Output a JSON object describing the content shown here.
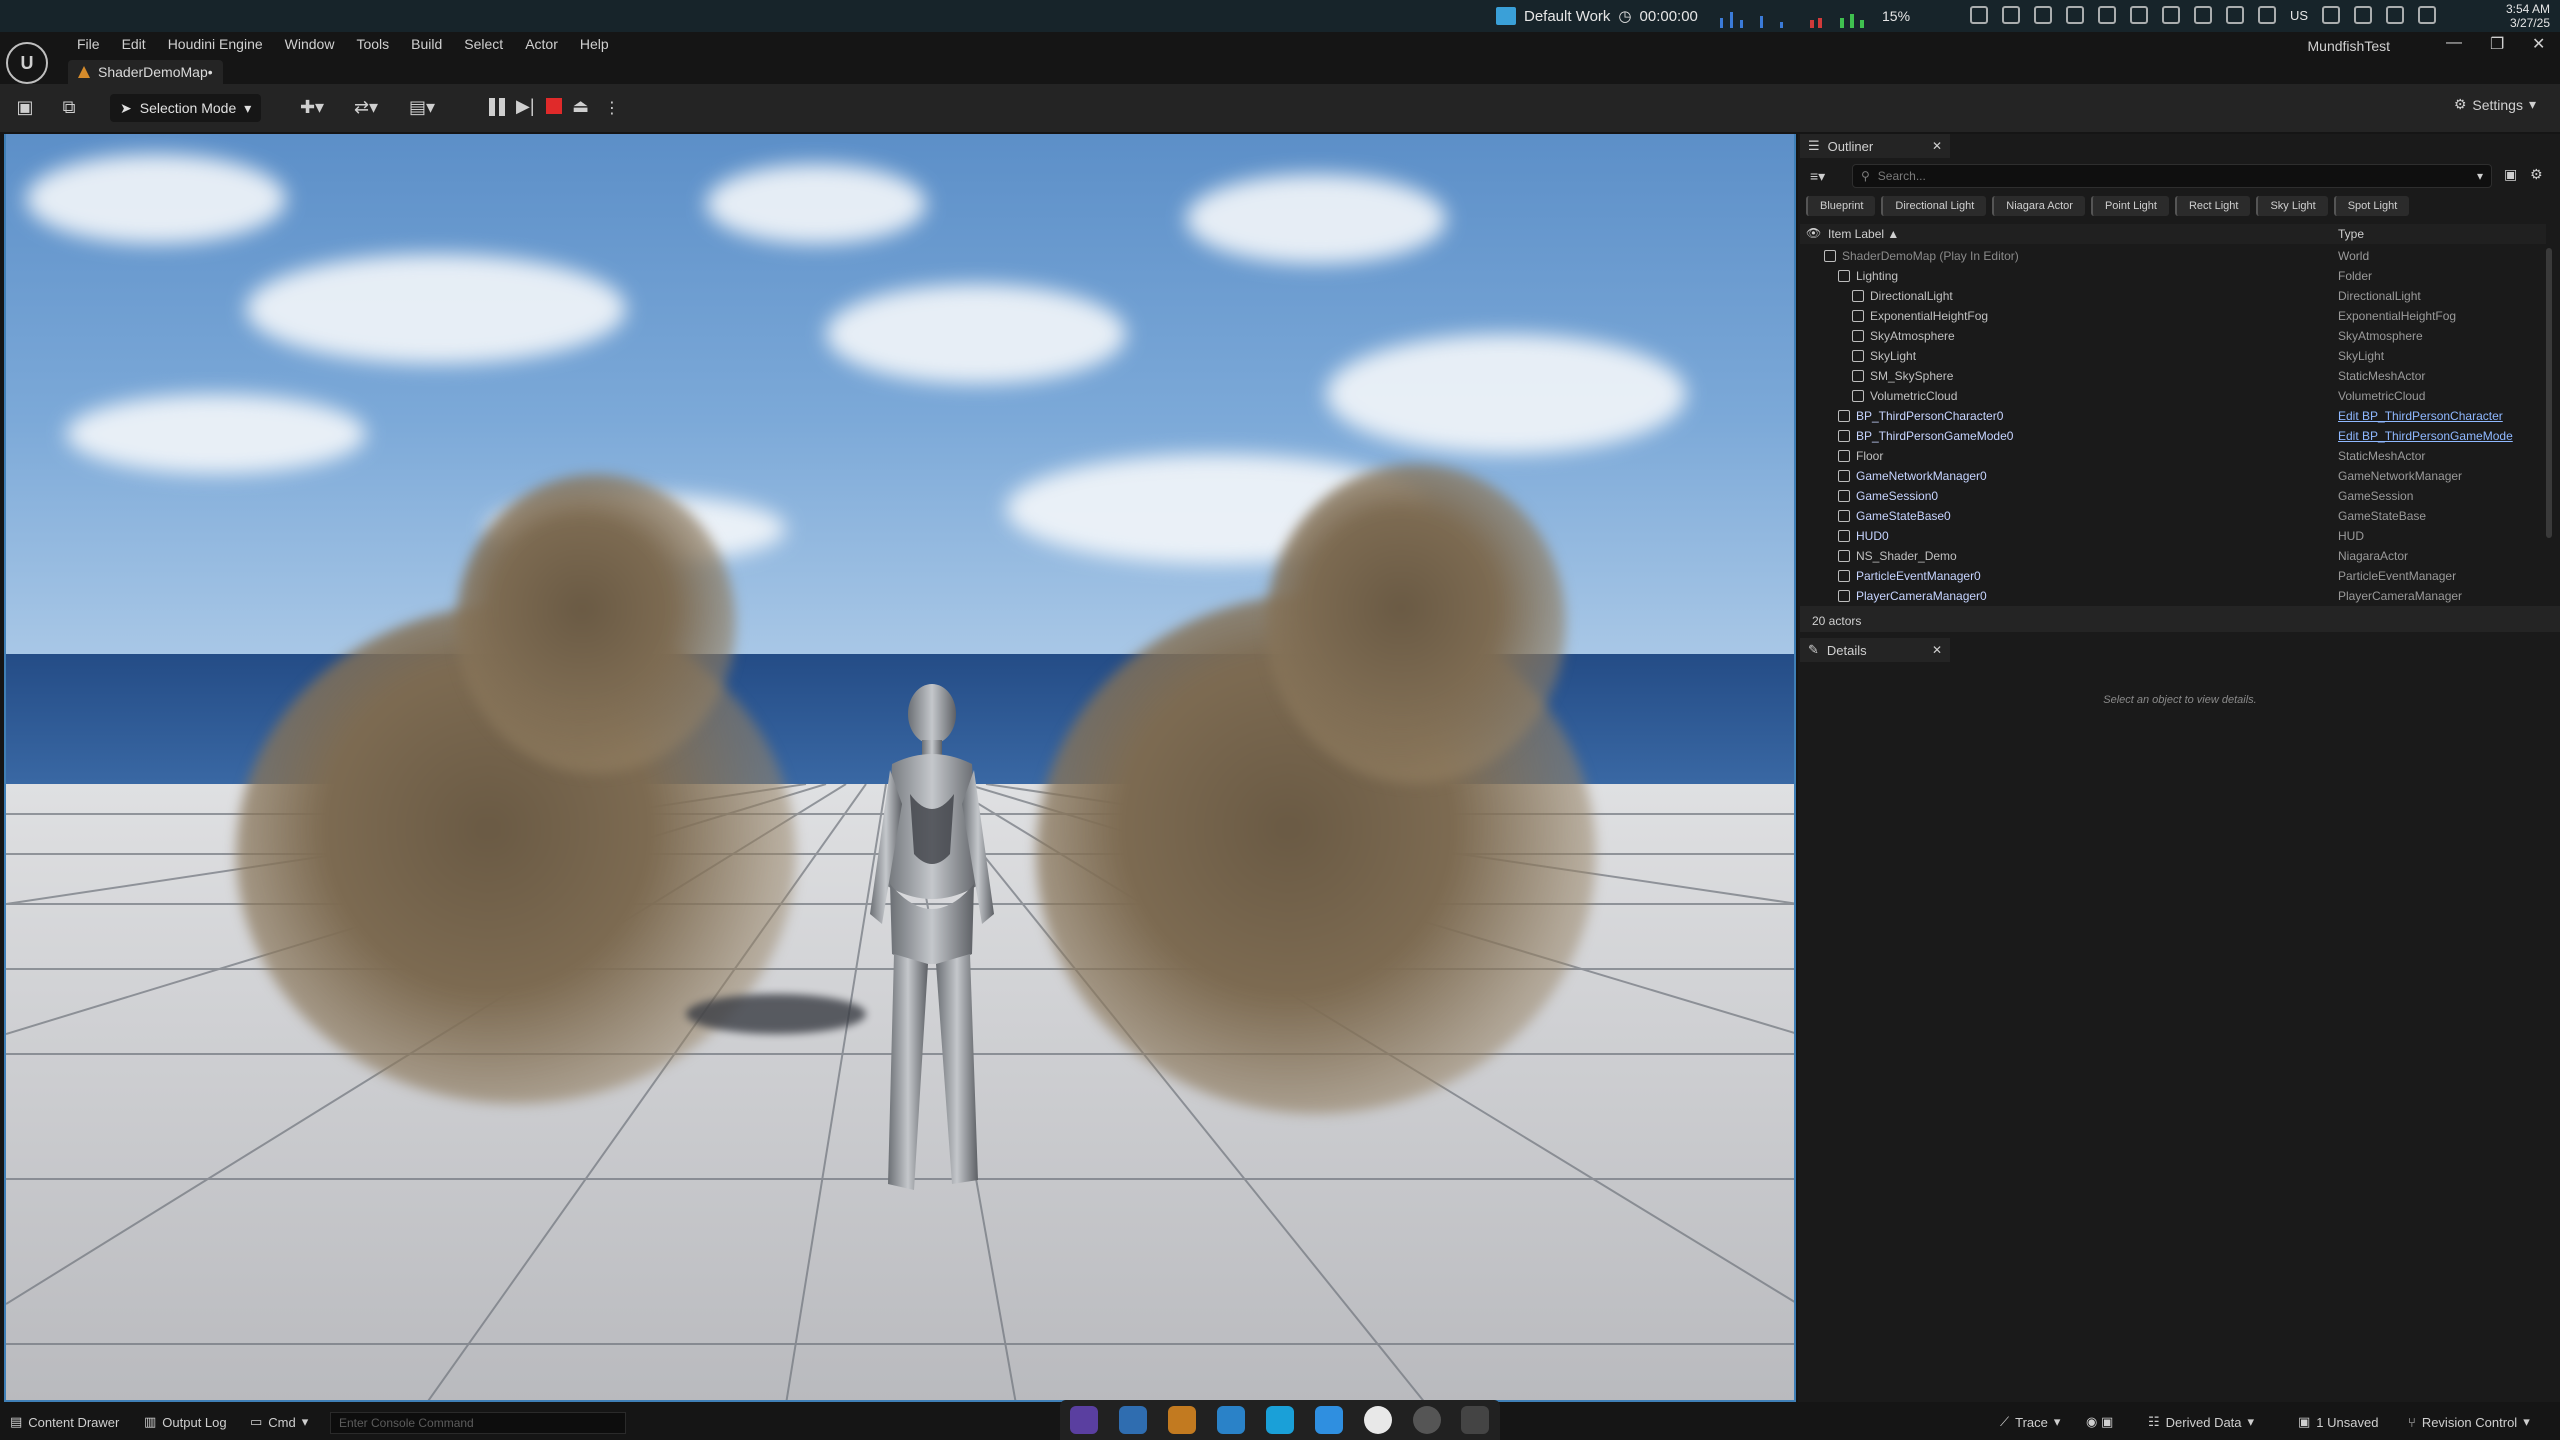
{
  "os": {
    "workspace": "Default Work",
    "timer": "00:00:00",
    "cpu": "15%",
    "kbd": "US",
    "time": "3:54 AM",
    "date": "3/27/25"
  },
  "editor": {
    "menus": [
      "File",
      "Edit",
      "Houdini Engine",
      "Window",
      "Tools",
      "Build",
      "Select",
      "Actor",
      "Help"
    ],
    "document_tab": "ShaderDemoMap•",
    "project": "MundfishTest",
    "selection_mode": "Selection Mode",
    "settings": "Settings"
  },
  "outliner": {
    "tab": "Outliner",
    "search_placeholder": "Search...",
    "filters": [
      "Blueprint",
      "Directional Light",
      "Niagara Actor",
      "Point Light",
      "Rect Light",
      "Sky Light",
      "Spot Light"
    ],
    "col_label": "Item Label ▲",
    "col_type": "Type",
    "rows": [
      {
        "label": "ShaderDemoMap (Play In Editor)",
        "type": "World",
        "indent": 0,
        "style": "inactive"
      },
      {
        "label": "Lighting",
        "type": "Folder",
        "indent": 1,
        "style": "normal"
      },
      {
        "label": "DirectionalLight",
        "type": "DirectionalLight",
        "indent": 2,
        "style": "normal"
      },
      {
        "label": "ExponentialHeightFog",
        "type": "ExponentialHeightFog",
        "indent": 2,
        "style": "normal"
      },
      {
        "label": "SkyAtmosphere",
        "type": "SkyAtmosphere",
        "indent": 2,
        "style": "normal"
      },
      {
        "label": "SkyLight",
        "type": "SkyLight",
        "indent": 2,
        "style": "normal"
      },
      {
        "label": "SM_SkySphere",
        "type": "StaticMeshActor",
        "indent": 2,
        "style": "normal"
      },
      {
        "label": "VolumetricCloud",
        "type": "VolumetricCloud",
        "indent": 2,
        "style": "normal"
      },
      {
        "label": "BP_ThirdPersonCharacter0",
        "type": "Edit BP_ThirdPersonCharacter",
        "indent": 1,
        "style": "active",
        "link": true
      },
      {
        "label": "BP_ThirdPersonGameMode0",
        "type": "Edit BP_ThirdPersonGameMode",
        "indent": 1,
        "style": "active",
        "link": true
      },
      {
        "label": "Floor",
        "type": "StaticMeshActor",
        "indent": 1,
        "style": "normal"
      },
      {
        "label": "GameNetworkManager0",
        "type": "GameNetworkManager",
        "indent": 1,
        "style": "active"
      },
      {
        "label": "GameSession0",
        "type": "GameSession",
        "indent": 1,
        "style": "active"
      },
      {
        "label": "GameStateBase0",
        "type": "GameStateBase",
        "indent": 1,
        "style": "active"
      },
      {
        "label": "HUD0",
        "type": "HUD",
        "indent": 1,
        "style": "active"
      },
      {
        "label": "NS_Shader_Demo",
        "type": "NiagaraActor",
        "indent": 1,
        "style": "normal"
      },
      {
        "label": "ParticleEventManager0",
        "type": "ParticleEventManager",
        "indent": 1,
        "style": "active"
      },
      {
        "label": "PlayerCameraManager0",
        "type": "PlayerCameraManager",
        "indent": 1,
        "style": "active"
      }
    ],
    "actor_count": "20 actors"
  },
  "details": {
    "tab": "Details",
    "empty": "Select an object to view details."
  },
  "status": {
    "content_drawer": "Content Drawer",
    "output_log": "Output Log",
    "cmd": "Cmd",
    "console_placeholder": "Enter Console Command",
    "trace": "Trace",
    "derived_data": "Derived Data",
    "unsaved": "1 Unsaved",
    "revision": "Revision Control"
  }
}
